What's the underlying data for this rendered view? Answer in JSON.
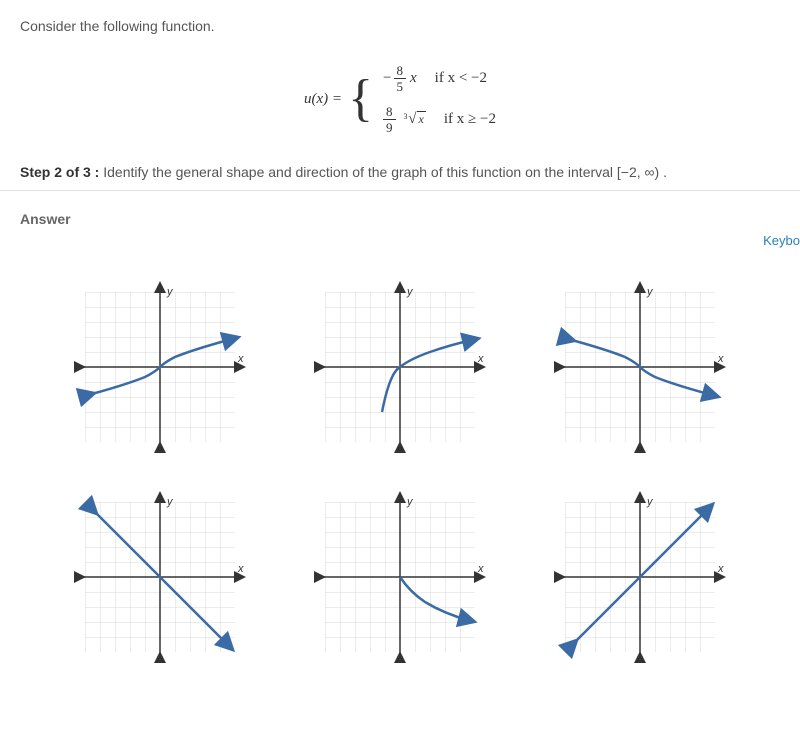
{
  "prompt": "Consider the following function.",
  "function": {
    "name": "u(x) =",
    "case1": {
      "neg": "−",
      "num": "8",
      "den": "5",
      "var": "x",
      "cond": "if x < −2"
    },
    "case2": {
      "num": "8",
      "den": "9",
      "rootIndex": "3",
      "rootArg": "x",
      "cond": "if x ≥ −2"
    }
  },
  "step": {
    "label": "Step 2 of 3 :",
    "text": "  Identify the general shape and direction of the graph of this function on the interval [−2, ∞)  ."
  },
  "answerLabel": "Answer",
  "keyboardLink": "Keybo",
  "axisLabels": {
    "x": "x",
    "y": "y"
  },
  "chart_data": [
    {
      "type": "line",
      "description": "cube-root-increasing-through-origin",
      "title": "",
      "xlabel": "x",
      "ylabel": "y",
      "xlim": [
        -5,
        5
      ],
      "ylim": [
        -5,
        5
      ],
      "series": [
        {
          "name": "curve",
          "x": [
            -5,
            -3,
            -1,
            0,
            1,
            3,
            5
          ],
          "values": [
            -1.7,
            -1.44,
            -1,
            0,
            1,
            1.44,
            1.7
          ]
        }
      ]
    },
    {
      "type": "line",
      "description": "square-root-like-increasing-from-left",
      "title": "",
      "xlabel": "x",
      "ylabel": "y",
      "xlim": [
        -5,
        5
      ],
      "ylim": [
        -5,
        5
      ],
      "series": [
        {
          "name": "curve",
          "x": [
            -2,
            -1,
            0,
            1,
            2,
            3,
            4,
            5
          ],
          "values": [
            -2,
            -0.5,
            0,
            0.7,
            1.1,
            1.4,
            1.6,
            1.8
          ]
        }
      ]
    },
    {
      "type": "line",
      "description": "cube-root-decreasing-reflected",
      "title": "",
      "xlabel": "x",
      "ylabel": "y",
      "xlim": [
        -5,
        5
      ],
      "ylim": [
        -5,
        5
      ],
      "series": [
        {
          "name": "curve",
          "x": [
            -5,
            -3,
            -1,
            0,
            1,
            3,
            5
          ],
          "values": [
            1.7,
            1.44,
            1,
            0,
            -1,
            -1.44,
            -1.7
          ]
        }
      ]
    },
    {
      "type": "line",
      "description": "linear-negative-slope",
      "title": "",
      "xlabel": "x",
      "ylabel": "y",
      "xlim": [
        -5,
        5
      ],
      "ylim": [
        -5,
        5
      ],
      "series": [
        {
          "name": "line",
          "x": [
            -5,
            5
          ],
          "values": [
            5,
            -5
          ]
        }
      ]
    },
    {
      "type": "line",
      "description": "square-root-like-decreasing-right-half",
      "title": "",
      "xlabel": "x",
      "ylabel": "y",
      "xlim": [
        -5,
        5
      ],
      "ylim": [
        -5,
        5
      ],
      "series": [
        {
          "name": "curve",
          "x": [
            0,
            1,
            2,
            3,
            4,
            5
          ],
          "values": [
            0,
            -1,
            -1.4,
            -1.7,
            -2,
            -2.2
          ]
        }
      ]
    },
    {
      "type": "line",
      "description": "linear-positive-slope",
      "title": "",
      "xlabel": "x",
      "ylabel": "y",
      "xlim": [
        -5,
        5
      ],
      "ylim": [
        -5,
        5
      ],
      "series": [
        {
          "name": "line",
          "x": [
            -5,
            5
          ],
          "values": [
            -5,
            5
          ]
        }
      ]
    }
  ]
}
